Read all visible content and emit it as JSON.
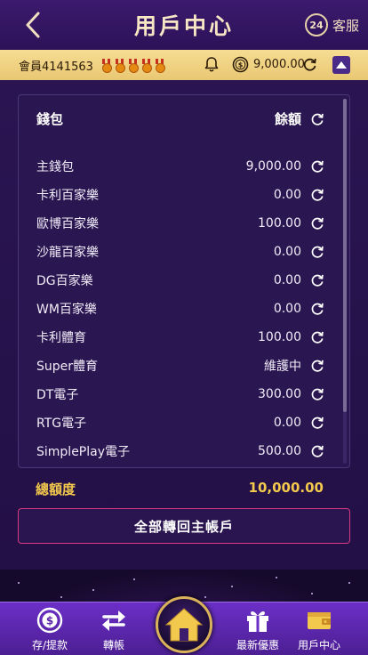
{
  "header": {
    "title": "用戶中心",
    "service_badge": "24",
    "service_label": "客服"
  },
  "member": {
    "name": "會員4141563",
    "medal_count": 5,
    "balance": "9,000.00"
  },
  "wallet": {
    "title": "錢包",
    "balance_label": "餘額",
    "rows": [
      {
        "name": "主錢包",
        "amount": "9,000.00"
      },
      {
        "name": "卡利百家樂",
        "amount": "0.00"
      },
      {
        "name": "歐博百家樂",
        "amount": "100.00"
      },
      {
        "name": "沙龍百家樂",
        "amount": "0.00"
      },
      {
        "name": "DG百家樂",
        "amount": "0.00"
      },
      {
        "name": "WM百家樂",
        "amount": "0.00"
      },
      {
        "name": "卡利體育",
        "amount": "100.00"
      },
      {
        "name": "Super體育",
        "amount": "維護中"
      },
      {
        "name": "DT電子",
        "amount": "300.00"
      },
      {
        "name": "RTG電子",
        "amount": "0.00"
      },
      {
        "name": "SimplePlay電子",
        "amount": "500.00"
      }
    ]
  },
  "total": {
    "label": "總額度",
    "amount": "10,000.00"
  },
  "transfer_button": "全部轉回主帳戶",
  "nav": {
    "deposit": "存/提款",
    "transfer": "轉帳",
    "promos": "最新優惠",
    "user_center": "用戶中心"
  },
  "colors": {
    "gold": "#f2c94c",
    "accent_pink": "#d63a83",
    "member_bar": "#f6dc92",
    "nav_purple": "#6b2fc7"
  }
}
